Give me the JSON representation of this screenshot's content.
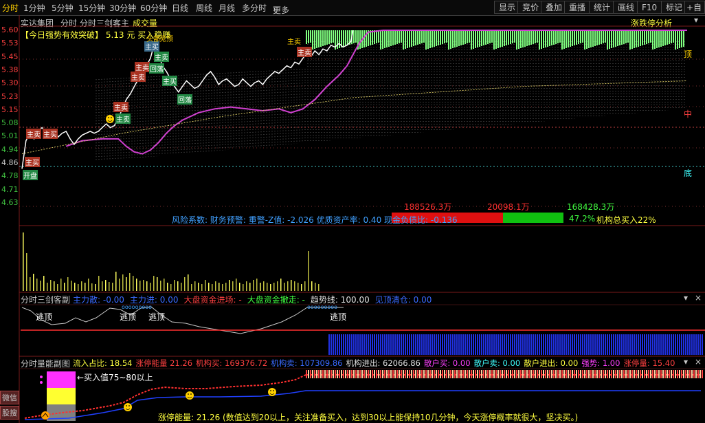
{
  "toolbar": {
    "periods": [
      "分时",
      "1分钟",
      "5分钟",
      "15分钟",
      "30分钟",
      "60分钟",
      "日线",
      "周线",
      "月线",
      "多分时",
      "更多"
    ],
    "right_buttons": [
      "显示",
      "竞价",
      "叠加",
      "重播",
      "统计",
      "画线",
      "F10",
      "标记",
      "+自选"
    ]
  },
  "header": {
    "stock_name": "实达集团",
    "mode": "分时",
    "indicator": "分时三剑客主",
    "volume_label": "成交量",
    "limit_label": "涨跌停分析"
  },
  "signal": {
    "bracket_text": "【今日强势有效突破】",
    "price_text": "5.13 元",
    "action_text": "买入稳赚"
  },
  "price_axis": [
    "5.60",
    "5.53",
    "5.45",
    "5.38",
    "5.30",
    "5.23",
    "5.15",
    "5.08",
    "5.01",
    "4.94",
    "4.86",
    "4.78",
    "4.71",
    "4.63"
  ],
  "zones": {
    "top": "顶",
    "mid": "中",
    "bottom": "底"
  },
  "price_chart_tags": [
    "开盘",
    "主买",
    "主卖",
    "主买",
    "主卖",
    "主卖",
    "主卖",
    "主卖",
    "主卖",
    "回落",
    "主买",
    "回落",
    "主买",
    "主卖",
    "主卖",
    "头部",
    "见顶"
  ],
  "fund_bars": {
    "left_value": "188526.3万",
    "mid_value": "20098.1万",
    "right_value": "168428.3万",
    "red_fraction": 0.55,
    "green_fraction": 0.45
  },
  "risk_line": {
    "text": "风险系数: 财务预警: 重警-Z值: -2.026 优质资产率: 0.40 现金负债比: -0.136",
    "pct": "47.2%",
    "inst_text": "机构总买入22%"
  },
  "sub1": {
    "title": "分时三剑客副",
    "items": [
      {
        "label": "主力散:",
        "value": "-0.00",
        "color": "#3a6aff"
      },
      {
        "label": "主力进:",
        "value": "0.00",
        "color": "#3a6aff"
      },
      {
        "label": "大盘资金进场:",
        "value": "-",
        "color": "#ff4040"
      },
      {
        "label": "大盘资金撤走:",
        "value": "-",
        "color": "#40ff40"
      },
      {
        "label": "趋势线:",
        "value": "100.00",
        "color": "#e0e0e0"
      },
      {
        "label": "见顶清仓:",
        "value": "0.00",
        "color": "#3a6aff"
      }
    ],
    "tags": [
      "逃顶",
      "逃顶",
      "逃顶",
      "逃顶"
    ],
    "dots_label": "ooooooooo"
  },
  "sub2": {
    "title": "分时量能副图",
    "items": [
      {
        "label": "流入占比:",
        "value": "18.54",
        "color": "#ffff40"
      },
      {
        "label": "涨停能量",
        "value": "21.26",
        "color": "#ff4040"
      },
      {
        "label": "机构买:",
        "value": "169376.72",
        "color": "#ff4040"
      },
      {
        "label": "机构卖:",
        "value": "107309.86",
        "color": "#3a6aff"
      },
      {
        "label": "机构进出:",
        "value": "62066.86",
        "color": "#e0e0e0"
      },
      {
        "label": "散户买:",
        "value": "0.00",
        "color": "#ff40ff"
      },
      {
        "label": "散户卖:",
        "value": "0.00",
        "color": "#40ffff"
      },
      {
        "label": "散户进出:",
        "value": "0.00",
        "color": "#ffff40"
      },
      {
        "label": "强势:",
        "value": "1.00",
        "color": "#ff40ff"
      },
      {
        "label": "涨停量:",
        "value": "15.40",
        "color": "#ff4040"
      }
    ],
    "buy_hint": "←买入值75~80以上",
    "energy_text": "涨停能量: 21.26 (数值达到20以上，关注准备买入，达到30以上能保持10几分钟，今天涨停概率就很大，坚决买。)"
  },
  "left_buttons": [
    "微信",
    "股搜"
  ],
  "price_line": [
    [
      0,
      4.86
    ],
    [
      4,
      5.01
    ],
    [
      8,
      5.05
    ],
    [
      12,
      5.02
    ],
    [
      16,
      5.06
    ],
    [
      20,
      5.08
    ],
    [
      24,
      5.05
    ],
    [
      28,
      5.04
    ],
    [
      32,
      5.06
    ],
    [
      36,
      5.03
    ],
    [
      40,
      5.05
    ],
    [
      44,
      5.06
    ],
    [
      48,
      5.02
    ],
    [
      52,
      4.99
    ],
    [
      56,
      5.02
    ],
    [
      60,
      5.04
    ],
    [
      64,
      5.05
    ],
    [
      68,
      5.06
    ],
    [
      72,
      5.05
    ],
    [
      76,
      5.06
    ],
    [
      80,
      5.08
    ],
    [
      84,
      5.1
    ],
    [
      88,
      5.08
    ],
    [
      92,
      5.09
    ],
    [
      96,
      5.13
    ],
    [
      100,
      5.18
    ],
    [
      104,
      5.23
    ],
    [
      108,
      5.26
    ],
    [
      112,
      5.3
    ],
    [
      116,
      5.34
    ],
    [
      120,
      5.38
    ],
    [
      124,
      5.41
    ],
    [
      128,
      5.45
    ],
    [
      130,
      5.49
    ],
    [
      133,
      5.52
    ],
    [
      136,
      5.47
    ],
    [
      140,
      5.41
    ],
    [
      144,
      5.38
    ],
    [
      148,
      5.34
    ],
    [
      152,
      5.3
    ],
    [
      156,
      5.27
    ],
    [
      160,
      5.3
    ],
    [
      164,
      5.33
    ],
    [
      168,
      5.31
    ],
    [
      172,
      5.29
    ],
    [
      176,
      5.3
    ],
    [
      180,
      5.33
    ],
    [
      184,
      5.36
    ],
    [
      188,
      5.38
    ],
    [
      192,
      5.35
    ],
    [
      196,
      5.31
    ],
    [
      200,
      5.33
    ],
    [
      204,
      5.34
    ],
    [
      208,
      5.32
    ],
    [
      212,
      5.3
    ],
    [
      216,
      5.31
    ],
    [
      220,
      5.34
    ],
    [
      224,
      5.32
    ],
    [
      228,
      5.3
    ],
    [
      232,
      5.32
    ],
    [
      236,
      5.33
    ],
    [
      240,
      5.31
    ],
    [
      244,
      5.34
    ],
    [
      248,
      5.36
    ],
    [
      252,
      5.38
    ],
    [
      256,
      5.37
    ],
    [
      260,
      5.39
    ],
    [
      264,
      5.41
    ],
    [
      268,
      5.4
    ],
    [
      272,
      5.43
    ],
    [
      276,
      5.42
    ],
    [
      280,
      5.45
    ],
    [
      284,
      5.48
    ],
    [
      288,
      5.46
    ],
    [
      292,
      5.49
    ],
    [
      296,
      5.47
    ],
    [
      300,
      5.5
    ],
    [
      304,
      5.49
    ],
    [
      308,
      5.52
    ],
    [
      312,
      5.51
    ],
    [
      316,
      5.53
    ],
    [
      320,
      5.51
    ],
    [
      324,
      5.52
    ],
    [
      328,
      5.54
    ],
    [
      330,
      5.6
    ]
  ],
  "avg_line": [
    [
      44,
      4.98
    ],
    [
      60,
      5.01
    ],
    [
      80,
      5.02
    ],
    [
      96,
      5.02
    ],
    [
      104,
      4.98
    ],
    [
      112,
      4.95
    ],
    [
      120,
      4.94
    ],
    [
      128,
      4.96
    ],
    [
      136,
      5.0
    ],
    [
      144,
      5.05
    ],
    [
      152,
      5.09
    ],
    [
      160,
      5.12
    ],
    [
      176,
      5.16
    ],
    [
      192,
      5.18
    ],
    [
      208,
      5.19
    ],
    [
      224,
      5.18
    ],
    [
      240,
      5.17
    ],
    [
      256,
      5.18
    ],
    [
      268,
      5.16
    ],
    [
      280,
      5.18
    ],
    [
      292,
      5.23
    ],
    [
      304,
      5.3
    ],
    [
      316,
      5.36
    ],
    [
      324,
      5.41
    ],
    [
      330,
      5.47
    ],
    [
      336,
      5.53
    ],
    [
      345,
      5.59
    ],
    [
      360,
      5.6
    ],
    [
      999,
      5.6
    ]
  ]
}
